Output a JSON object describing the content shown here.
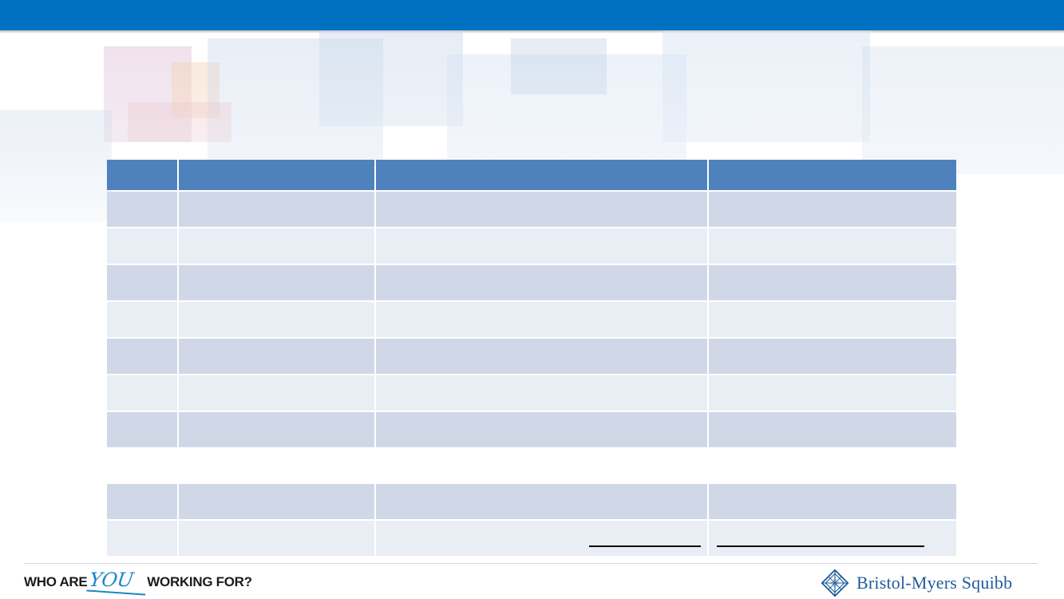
{
  "slide": {
    "header_color": "#0070c0",
    "table_header_color": "#4f81bd",
    "row_dark_color": "#d0d8e8",
    "row_light_color": "#e9edf4"
  },
  "table": {
    "columns": [
      "",
      "",
      "",
      ""
    ],
    "rows": [
      [
        "",
        "",
        "",
        ""
      ],
      [
        "",
        "",
        "",
        ""
      ],
      [
        "",
        "",
        "",
        ""
      ],
      [
        "",
        "",
        "",
        ""
      ],
      [
        "",
        "",
        "",
        ""
      ],
      [
        "",
        "",
        "",
        ""
      ],
      [
        "",
        "",
        "",
        ""
      ]
    ],
    "bottom_rows": [
      [
        "",
        "",
        "",
        ""
      ],
      [
        "",
        "",
        "",
        ""
      ]
    ]
  },
  "footer": {
    "tagline_before": "WHO ARE",
    "tagline_you": "YOU",
    "tagline_after": "WORKING FOR?",
    "logo_icon": "bms-diamond-logo-icon",
    "company_name": "Bristol-Myers Squibb"
  }
}
